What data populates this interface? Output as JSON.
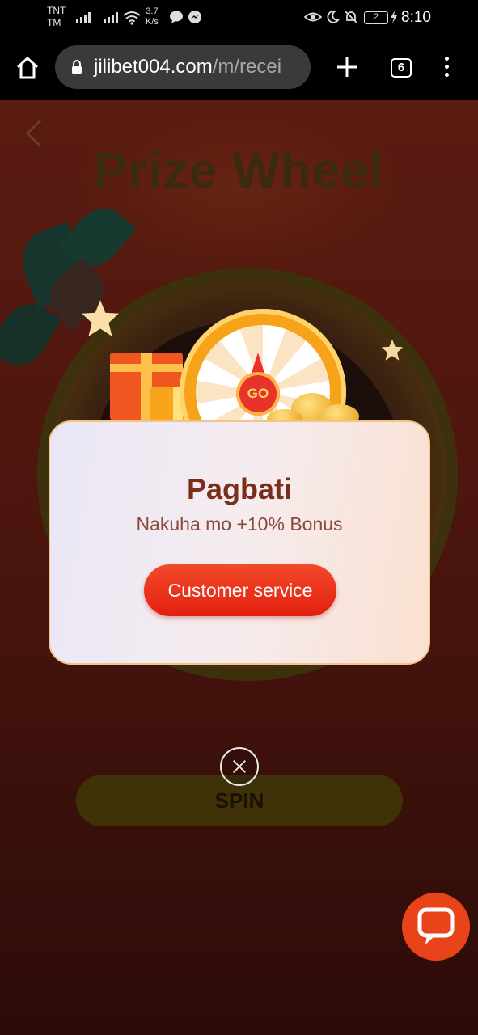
{
  "status_bar": {
    "carrier_line1": "TNT",
    "carrier_line2": "TM",
    "speed_value": "3.7",
    "speed_unit": "K/s",
    "battery": "2",
    "time": "8:10"
  },
  "browser": {
    "url_host": "jilibet004.com",
    "url_path": "/m/recei",
    "tab_count": "6"
  },
  "page": {
    "title": "Prize Wheel",
    "wheel_go_label": "GO",
    "spin_label": "SPIN"
  },
  "modal": {
    "title": "Pagbati",
    "subtitle": "Nakuha mo +10% Bonus",
    "button_label": "Customer service"
  },
  "colors": {
    "accent": "#e9431a",
    "modal_title": "#7a2d1a",
    "page_bg": "#4e160e"
  }
}
